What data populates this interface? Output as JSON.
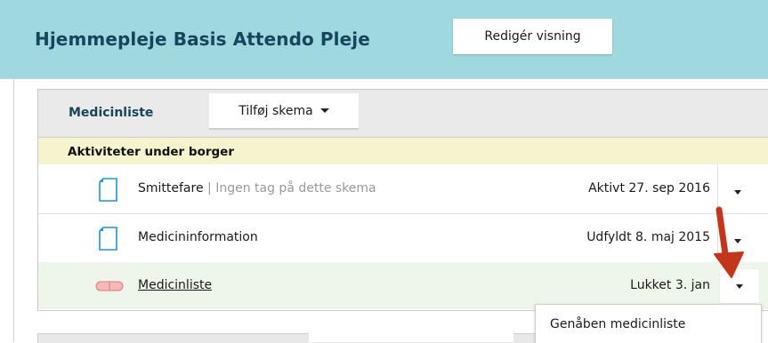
{
  "header": {
    "title": "Hjemmepleje Basis Attendo Pleje",
    "edit_view_label": "Redigér visning",
    "background_color": "#9fd8df"
  },
  "panel": {
    "title": "Medicinliste",
    "add_schema_label": "Tilføj skema",
    "group_title": "Aktiviteter under borger",
    "rows": [
      {
        "icon": "document-icon",
        "label": "Smittefare",
        "separator": "|",
        "tag_text": "Ingen tag på dette skema",
        "status": "Aktivt 27. sep 2016"
      },
      {
        "icon": "document-icon",
        "label": "Medicininformation",
        "status": "Udfyldt 8. maj 2015"
      },
      {
        "icon": "pill-icon",
        "label": "Medicinliste",
        "status": "Lukket 3. jan"
      }
    ]
  },
  "dropdown": {
    "items": [
      "Genåben medicinliste"
    ]
  },
  "annotation": {
    "arrow_color": "#c2361c"
  }
}
